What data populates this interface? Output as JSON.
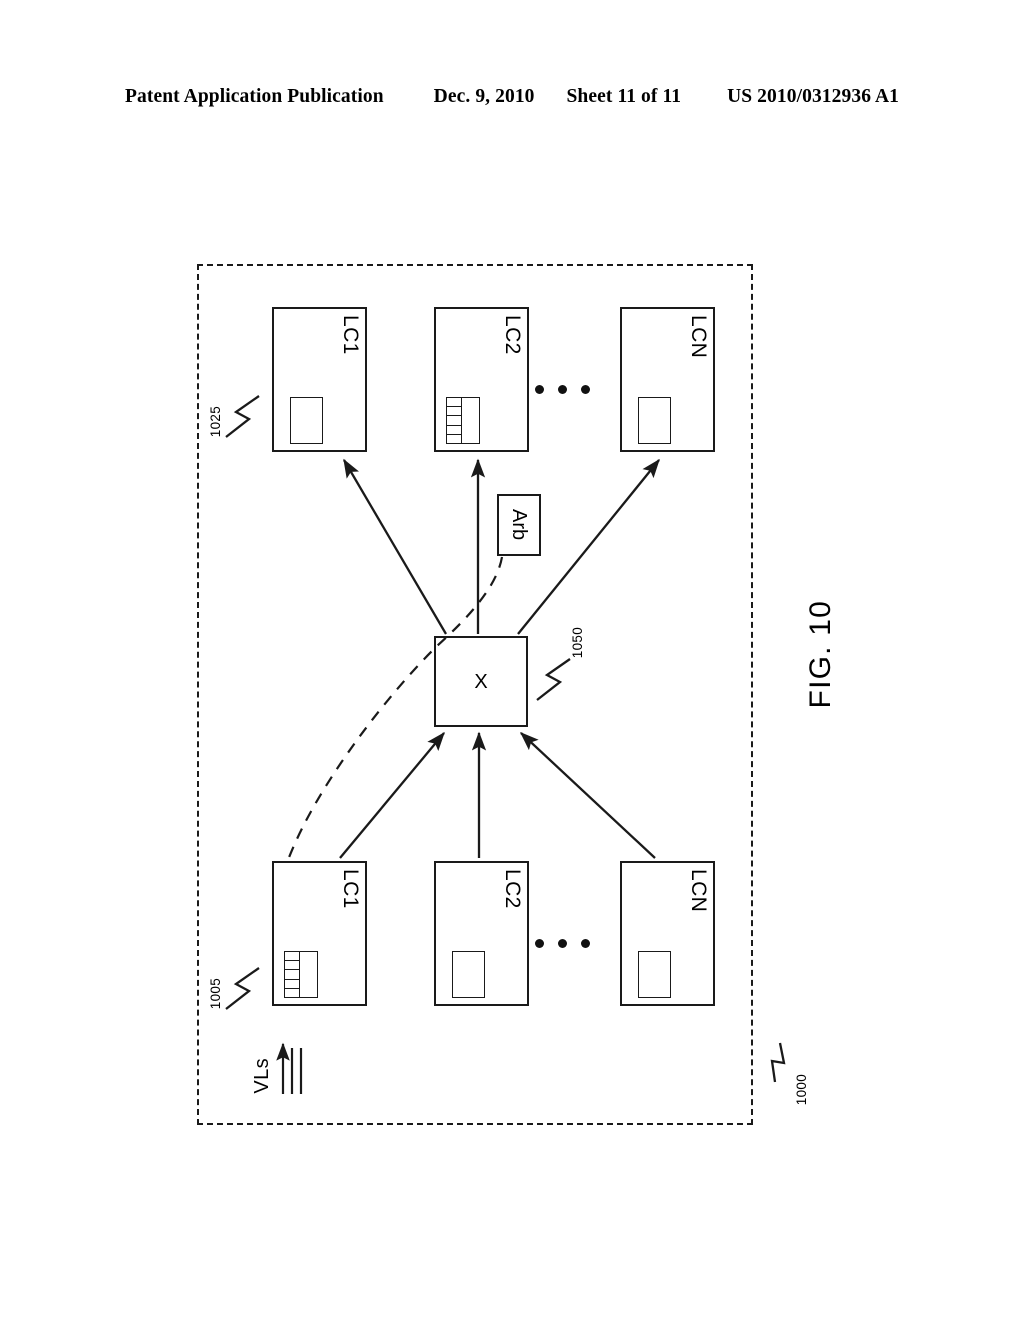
{
  "header": {
    "publication": "Patent Application Publication",
    "date": "Dec. 9, 2010",
    "sheet": "Sheet 11 of 11",
    "patent_number": "US 2010/0312936 A1"
  },
  "figure": {
    "caption": "FIG. 10",
    "chassis_ref": "1000",
    "egress_group_ref": "1025",
    "ingress_group_ref": "1005",
    "crossbar_ref": "1050",
    "crossbar_label": "X",
    "arbiter_label": "Arb",
    "vls_label": "VLs",
    "ellipsis_glyph": "•"
  },
  "egress_cards": [
    {
      "label": "LC1",
      "buffer": "empty"
    },
    {
      "label": "LC2",
      "buffer": "queued"
    },
    {
      "label": "LCN",
      "buffer": "empty"
    }
  ],
  "ingress_cards": [
    {
      "label": "LC1",
      "buffer": "queued"
    },
    {
      "label": "LC2",
      "buffer": "empty"
    },
    {
      "label": "LCN",
      "buffer": "empty"
    }
  ],
  "queue_cells": 5,
  "colors": {
    "ink": "#1a1a1a",
    "paper": "#ffffff"
  }
}
